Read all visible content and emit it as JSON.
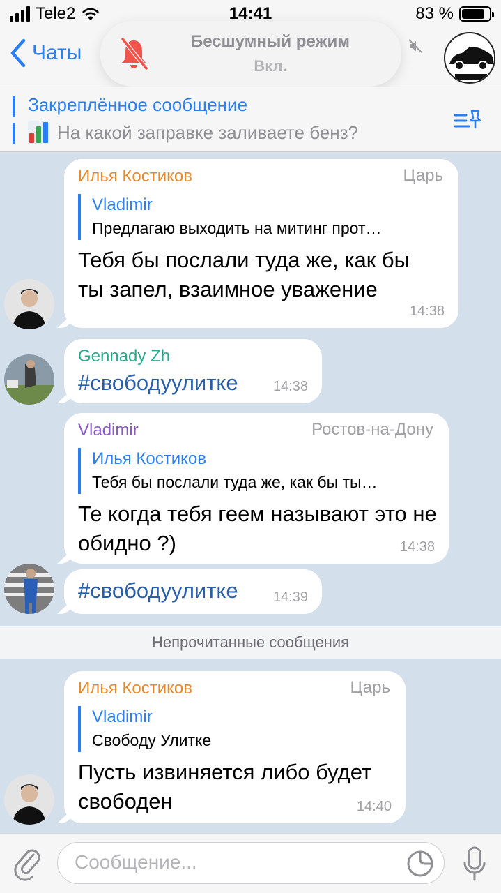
{
  "status": {
    "carrier": "Tele2",
    "time": "14:41",
    "battery": "83 %"
  },
  "nav": {
    "back_label": "Чаты"
  },
  "toast": {
    "title": "Бесшумный режим",
    "subtitle": "Вкл."
  },
  "pinned": {
    "title": "Закреплённое сообщение",
    "text": "На какой заправке заливаете бенз?"
  },
  "messages": [
    {
      "sender": "Илья Костиков",
      "role": "Царь",
      "reply_name": "Vladimir",
      "reply_text": "Предлагаю выходить на митинг прот…",
      "text": "Тебя бы послали туда же, как бы ты запел, взаимное уважение",
      "time": "14:38"
    },
    {
      "sender": "Gennady Zh",
      "text": "#свободуулитке",
      "time": "14:38"
    },
    {
      "sender": "Vladimir",
      "role": "Ростов-на-Дону",
      "reply_name": "Илья Костиков",
      "reply_text": "Тебя бы послали туда же, как бы ты…",
      "text": "Те когда тебя геем называют это не обидно ?)",
      "time": "14:38"
    },
    {
      "text": "#свободуулитке",
      "time": "14:39"
    },
    {
      "sender": "Илья Костиков",
      "role": "Царь",
      "reply_name": "Vladimir",
      "reply_text": "Свободу Улитке",
      "text": "Пусть извиняется либо будет свободен",
      "time": "14:40"
    }
  ],
  "unread_label": "Непрочитанные сообщения",
  "input": {
    "placeholder": "Сообщение..."
  },
  "colors": {
    "accent": "#2a7ff5",
    "orange_name": "#e8892b",
    "green_name": "#27a98e",
    "purple_name": "#8a5bc7"
  }
}
